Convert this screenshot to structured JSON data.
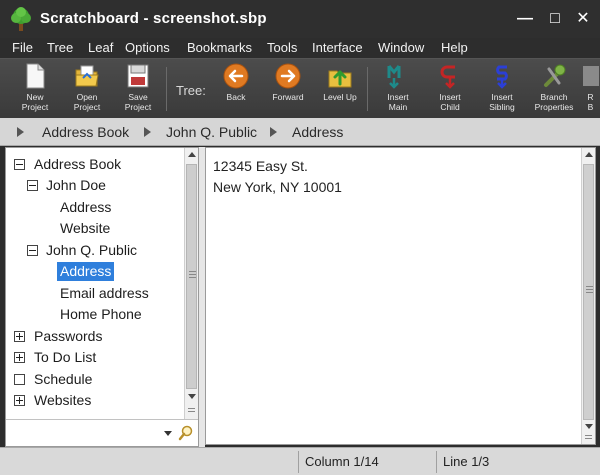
{
  "window": {
    "title": "Scratchboard - screenshot.sbp",
    "controls": {
      "minimize": "—",
      "maximize": "□",
      "close": "✕"
    }
  },
  "menu": [
    "File",
    "Tree",
    "Leaf",
    "Options",
    "Bookmarks",
    "Tools",
    "Interface",
    "Window",
    "Help"
  ],
  "toolbar": {
    "tree_label": "Tree:",
    "buttons": [
      {
        "line1": "New",
        "line2": "Project",
        "icon": "new-project-icon"
      },
      {
        "line1": "Open",
        "line2": "Project",
        "icon": "open-project-icon"
      },
      {
        "line1": "Save",
        "line2": "Project",
        "icon": "save-project-icon"
      },
      {
        "line1": "",
        "line2": "Back",
        "icon": "back-arrow-icon"
      },
      {
        "line1": "",
        "line2": "Forward",
        "icon": "forward-arrow-icon"
      },
      {
        "line1": "",
        "line2": "Level Up",
        "icon": "level-up-icon"
      },
      {
        "line1": "Insert",
        "line2": "Main",
        "icon": "insert-main-icon"
      },
      {
        "line1": "Insert",
        "line2": "Child",
        "icon": "insert-child-icon"
      },
      {
        "line1": "Insert",
        "line2": "Sibling",
        "icon": "insert-sibling-icon"
      },
      {
        "line1": "Branch",
        "line2": "Properties",
        "icon": "branch-properties-icon"
      },
      {
        "line1": "R",
        "line2": "B",
        "icon": "partial-button-icon"
      }
    ]
  },
  "breadcrumb": [
    "Address Book",
    "John Q. Public",
    "Address"
  ],
  "tree": {
    "nodes": [
      {
        "label": "Address Book",
        "expander": "minus"
      },
      {
        "label": "John Doe",
        "expander": "minus"
      },
      {
        "label": "Address",
        "expander": "none"
      },
      {
        "label": "Website",
        "expander": "none"
      },
      {
        "label": "John Q. Public",
        "expander": "minus"
      },
      {
        "label": "Address",
        "expander": "none",
        "selected": true
      },
      {
        "label": "Email address",
        "expander": "none"
      },
      {
        "label": "Home Phone",
        "expander": "none"
      },
      {
        "label": "Passwords",
        "expander": "plus"
      },
      {
        "label": "To Do List",
        "expander": "plus"
      },
      {
        "label": "Schedule",
        "expander": "empty"
      },
      {
        "label": "Websites",
        "expander": "plus"
      }
    ]
  },
  "editor": {
    "lines": [
      "12345 Easy St.",
      "New York, NY 10001"
    ]
  },
  "status": {
    "column": "Column 1/14",
    "line": "Line 1/3"
  },
  "colors": {
    "selection": "#2f7fdc",
    "titlebar": "#2f2f2f",
    "toolbar": "#444444"
  }
}
